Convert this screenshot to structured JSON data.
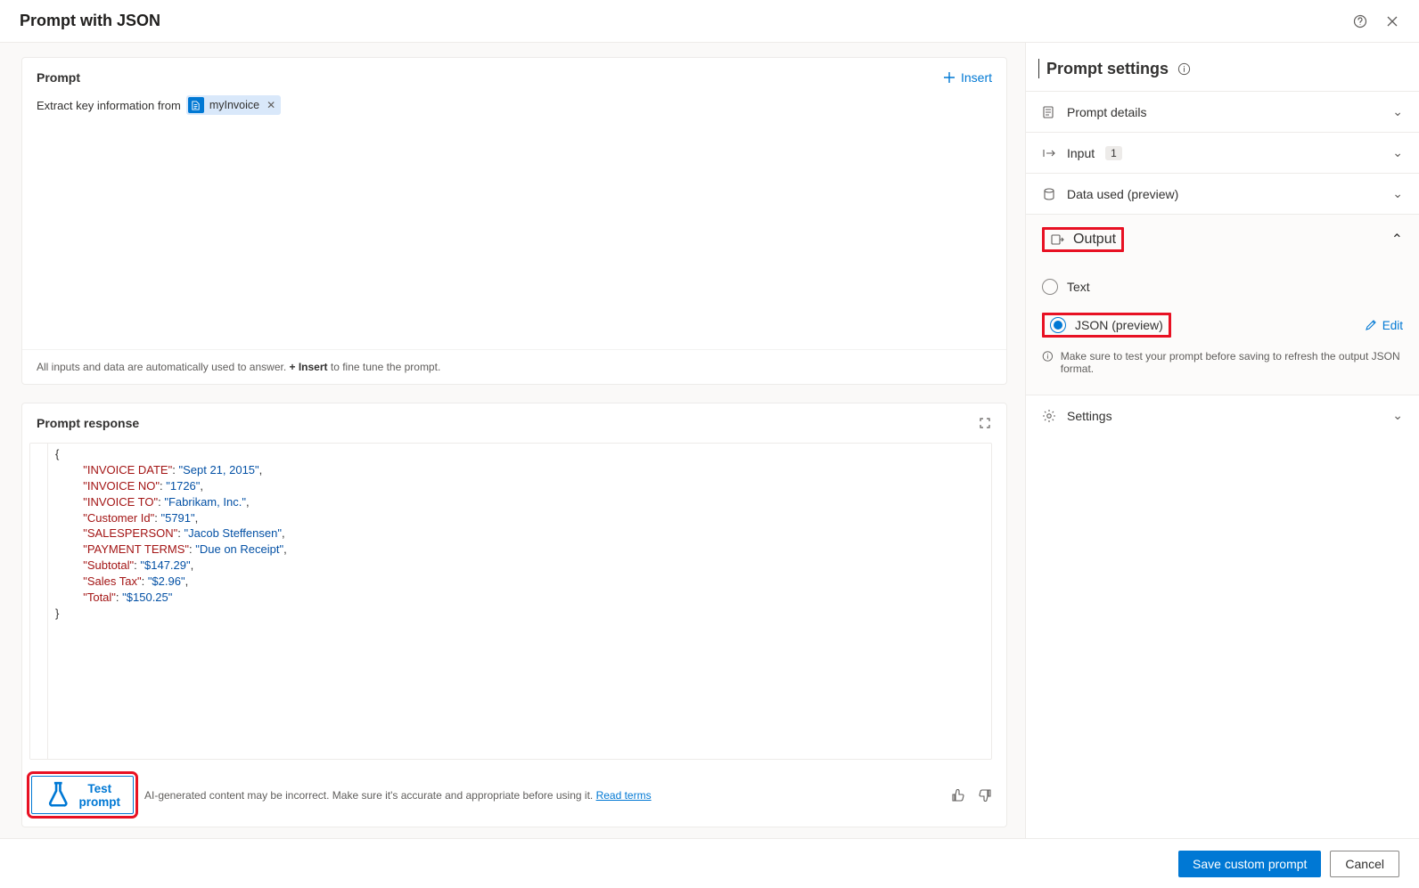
{
  "header": {
    "title": "Prompt with JSON"
  },
  "prompt": {
    "section_label": "Prompt",
    "insert_label": "Insert",
    "prefix_text": "Extract key information from",
    "chip_label": "myInvoice",
    "hint_prefix": "All inputs and data are automatically used to answer. ",
    "hint_bold": "+ Insert",
    "hint_suffix": " to fine tune the prompt."
  },
  "response": {
    "section_label": "Prompt response",
    "test_label": "Test prompt",
    "disclaimer_text": "AI-generated content may be incorrect. Make sure it's accurate and appropriate before using it. ",
    "read_terms": "Read terms",
    "json_pairs": [
      {
        "k": "INVOICE DATE",
        "v": "Sept 21, 2015"
      },
      {
        "k": "INVOICE NO",
        "v": "1726"
      },
      {
        "k": "INVOICE TO",
        "v": "Fabrikam, Inc."
      },
      {
        "k": "Customer Id",
        "v": "5791"
      },
      {
        "k": "SALESPERSON",
        "v": "Jacob Steffensen"
      },
      {
        "k": "PAYMENT TERMS",
        "v": "Due on Receipt"
      },
      {
        "k": "Subtotal",
        "v": "$147.29"
      },
      {
        "k": "Sales Tax",
        "v": "$2.96"
      },
      {
        "k": "Total",
        "v": "$150.25"
      }
    ]
  },
  "settings": {
    "title": "Prompt settings",
    "sections": {
      "details": "Prompt details",
      "input": "Input",
      "input_count": "1",
      "data_used": "Data used (preview)",
      "output": "Output",
      "settings": "Settings"
    },
    "output": {
      "text_option": "Text",
      "json_option": "JSON (preview)",
      "edit_label": "Edit",
      "note": "Make sure to test your prompt before saving to refresh the output JSON format."
    }
  },
  "footer": {
    "save": "Save custom prompt",
    "cancel": "Cancel"
  }
}
